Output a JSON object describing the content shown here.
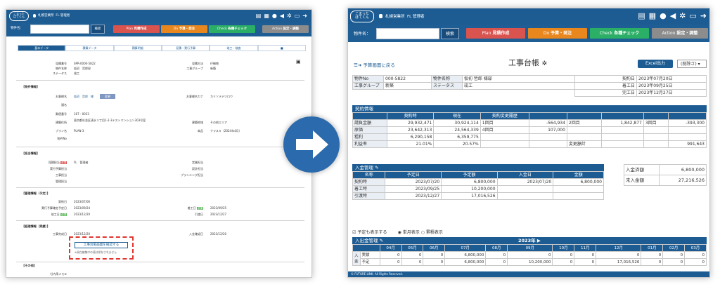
{
  "left": {
    "logo": "こまった\nはてくん",
    "office_tag": "札幌営業所",
    "user": "FL 管理者",
    "subnav": {
      "field_label": "物件名：",
      "search_button": "検索"
    },
    "phase_buttons": [
      {
        "tag": "Plan",
        "label": "見積作成"
      },
      {
        "tag": "Do",
        "label": "予算・発注"
      },
      {
        "tag": "Check",
        "label": "各種チェック"
      },
      {
        "tag": "Action",
        "label": "設定・調整"
      }
    ],
    "tabs": [
      "基本データ",
      "積算データ",
      "積算明細",
      "見積・実行予算",
      "竣工・検査",
      "■"
    ],
    "basic": [
      {
        "label": "見積番号",
        "value": "SPR-0000-5822"
      },
      {
        "label": "物件名称",
        "value": "仮初　哲郎邸"
      },
      {
        "label": "ステータス",
        "value": "竣工"
      }
    ],
    "basic_right": [
      {
        "label": "見積方法",
        "value": "仔細物"
      },
      {
        "label": "工事グループ",
        "value": "新築"
      }
    ],
    "property_title": "【物件情報】",
    "property": [
      {
        "label": "お客様名",
        "value": "仮初　哲郎　様"
      },
      {
        "label": "通名",
        "value": ""
      },
      {
        "label": "郵便番号",
        "value": "167 - 0033"
      },
      {
        "label": "建築住所",
        "value": "東京都杉並区清水３丁目1-2-3テストマンション303号室"
      },
      {
        "label": "プラン名",
        "value": "PLAN-3"
      },
      {
        "label": "物件No",
        "value": ""
      }
    ],
    "property_right": [
      {
        "label": "お客様名カナ",
        "value": "カリソメテツロウ"
      },
      {
        "label": "建築地域",
        "value": "その他エリア"
      },
      {
        "label": "商品",
        "value": "クラス５（2024年4月）"
      }
    ],
    "change_button": "変更",
    "staff_title": "【担当情報】",
    "staff": [
      {
        "label": "見積担当",
        "badge": "必須",
        "value": "FL　管理者"
      },
      {
        "label": "実行予算担当",
        "badge": "",
        "value": ""
      },
      {
        "label": "工事担当",
        "badge": "",
        "value": ""
      },
      {
        "label": "管理担当",
        "badge": "",
        "value": ""
      }
    ],
    "staff_right": [
      "営業担当",
      "設計担当",
      "プランニング担当"
    ],
    "plan_title": "【管理情報（予定）】",
    "plan": [
      {
        "label": "契約日",
        "badge": "",
        "value": "2023/07/06"
      },
      {
        "label": "実行予算確定予定日",
        "badge": "",
        "value": "2023/09/24"
      },
      {
        "label": "竣工日",
        "badge": "必須",
        "value": "2023/12/20"
      }
    ],
    "plan_right": [
      {
        "label": "着工日",
        "badge": "必須",
        "value": "2023/09/25"
      },
      {
        "label": "引渡日",
        "badge": "",
        "value": "2023/12/27"
      }
    ],
    "actual_title": "【経理情報（実績）】",
    "actual": [
      {
        "label": "工事完成日",
        "value": "2023/12/20"
      }
    ],
    "actual_right": [
      {
        "label": "入金確認日",
        "value": "2023/12/20"
      }
    ],
    "confirm_button": "工事台帳画面を確認する",
    "confirm_note": "※現在編集中の値は保存されません",
    "other_title": "【その他】",
    "other_label": "社内用メモ①"
  },
  "right": {
    "logo": "こまった\nはてくん",
    "office_tag": "札幌営業所",
    "user": "FL 管理者",
    "subnav": {
      "field_label": "物件名：",
      "search_button": "検索"
    },
    "phase_buttons": [
      {
        "tag": "Plan",
        "label": "見積作成"
      },
      {
        "tag": "Do",
        "label": "予算・発注"
      },
      {
        "tag": "Check",
        "label": "各種チェック"
      },
      {
        "tag": "Action",
        "label": "設定・調整"
      }
    ],
    "back_link": "予算画面に戻る",
    "page_title": "工事台帳",
    "excel_button": "Excel出力",
    "print_select": "(削除さ)",
    "info": {
      "property_no_label": "物件No",
      "property_no": "000-5822",
      "group_label": "工事グループ",
      "group": "新築",
      "name_label": "物件名称",
      "name": "仮初 哲郎 様邸",
      "status_label": "ステータス",
      "status": "竣工",
      "dates": [
        {
          "label": "契約日",
          "value": "2023年07月20日"
        },
        {
          "label": "着工日",
          "value": "2023年09月25日"
        },
        {
          "label": "完工日",
          "value": "2023年12月27日"
        }
      ]
    },
    "contract": {
      "title": "契約情報",
      "headers": [
        "",
        "契約時",
        "現在",
        "契約変更履歴",
        "",
        "",
        "",
        "",
        ""
      ],
      "rows": [
        [
          "請負金額",
          "29,932,471",
          "30,924,114",
          "1回目",
          "-564,934",
          "2回目",
          "1,842,877",
          "3回目",
          "-393,300"
        ],
        [
          "原価",
          "23,642,313",
          "24,564,339",
          "4回目",
          "107,000",
          "",
          "",
          "",
          ""
        ],
        [
          "粗利",
          "6,290,158",
          "6,359,775",
          "",
          "",
          "",
          "",
          "",
          ""
        ],
        [
          "利益率",
          "21.01%",
          "20.57%",
          "",
          "",
          "変更額計",
          "",
          "",
          "991,643"
        ]
      ]
    },
    "deposit": {
      "title": "入金管理",
      "headers": [
        "名称",
        "予定日",
        "予定額",
        "入金日",
        "金額"
      ],
      "rows": [
        [
          "契約時",
          "2023/07/20",
          "6,800,000",
          "2023/07/20",
          "6,800,000"
        ],
        [
          "着工時",
          "2023/09/25",
          "10,200,000",
          "",
          ""
        ],
        [
          "引渡時",
          "2023/12/27",
          "17,016,526",
          "",
          ""
        ]
      ],
      "summary": [
        {
          "label": "入金済額",
          "value": "6,800,000"
        },
        {
          "label": "未入金額",
          "value": "27,216,526"
        }
      ]
    },
    "options": {
      "show_plan": "予定も表示する",
      "monthly": "単月表示",
      "cumulative": "累積表示"
    },
    "cashflow": {
      "title": "入出金管理",
      "year": "2023年 ▶",
      "side_label": "入金",
      "months": [
        "04月",
        "05月",
        "06月",
        "07月",
        "08月",
        "09月",
        "10月",
        "11月",
        "12月",
        "01月",
        "02月",
        "03月"
      ],
      "rows": [
        {
          "label": "実績",
          "values": [
            "0",
            "0",
            "0",
            "6,800,000",
            "0",
            "0",
            "0",
            "0",
            "0",
            "0",
            "0",
            "0"
          ]
        },
        {
          "label": "予定",
          "values": [
            "0",
            "0",
            "0",
            "6,800,000",
            "0",
            "10,200,000",
            "0",
            "0",
            "17,016,526",
            "0",
            "0",
            "0"
          ]
        }
      ]
    },
    "footer": "© FUTURE LINK. All Rights Reserved."
  }
}
